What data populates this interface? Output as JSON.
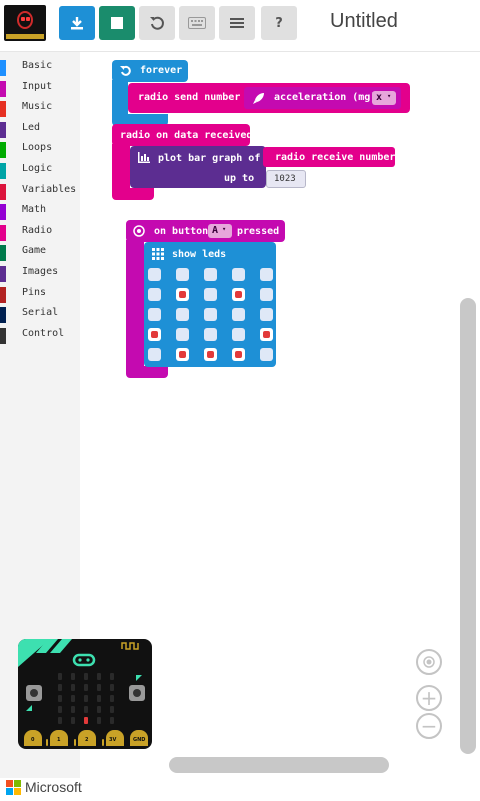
{
  "header": {
    "title": "Untitled",
    "buttons": {
      "download": {
        "icon": "download-icon",
        "color": "#1e90d6"
      },
      "stop": {
        "icon": "stop-icon",
        "color": "#1a8c6c"
      },
      "restart": {
        "icon": "restart-icon",
        "color": "#e0e0e0"
      },
      "keyboard": {
        "icon": "keyboard-icon",
        "color": "#e0e0e0"
      },
      "menu": {
        "icon": "menu-icon",
        "color": "#e0e0e0"
      },
      "help": {
        "label": "?",
        "color": "#e0e0e0"
      }
    }
  },
  "toolbox": {
    "categories": [
      {
        "label": "Basic",
        "color": "#1e90ff"
      },
      {
        "label": "Input",
        "color": "#c40ab0"
      },
      {
        "label": "Music",
        "color": "#e63022"
      },
      {
        "label": "Led",
        "color": "#5c2d91"
      },
      {
        "label": "Loops",
        "color": "#00aa00"
      },
      {
        "label": "Logic",
        "color": "#00a4a6"
      },
      {
        "label": "Variables",
        "color": "#dc143c"
      },
      {
        "label": "Math",
        "color": "#9400d3"
      },
      {
        "label": "Radio",
        "color": "#e3008c"
      },
      {
        "label": "Game",
        "color": "#007a4b"
      },
      {
        "label": "Images",
        "color": "#5c2d91"
      },
      {
        "label": "Pins",
        "color": "#b22222"
      },
      {
        "label": "Serial",
        "color": "#002050"
      },
      {
        "label": "Control",
        "color": "#333333"
      }
    ]
  },
  "blocks": {
    "forever": {
      "label": "forever",
      "icon": "refresh-icon"
    },
    "radio_send": {
      "label": "radio send number",
      "value_label": "acceleration (mg)",
      "value_icon": "rocket-icon",
      "axis": "x"
    },
    "on_data": {
      "label": "radio on data received"
    },
    "plot": {
      "label": "plot bar graph of",
      "up_to_label": "up to",
      "value_label": "radio receive number",
      "max": "1023",
      "icon": "bar-chart-icon"
    },
    "on_button": {
      "label": "on button",
      "button": "A",
      "suffix": "pressed"
    },
    "show_leds": {
      "label": "show leds",
      "icon": "grid-icon",
      "grid": [
        [
          0,
          0,
          0,
          0,
          0
        ],
        [
          0,
          1,
          0,
          1,
          0
        ],
        [
          0,
          0,
          0,
          0,
          0
        ],
        [
          1,
          0,
          0,
          0,
          1
        ],
        [
          0,
          1,
          1,
          1,
          0
        ]
      ]
    }
  },
  "simulator": {
    "pin_labels": [
      "0",
      "1",
      "2",
      "3V",
      "GND"
    ],
    "leds_on": [
      [
        4,
        2
      ]
    ]
  },
  "footer": {
    "brand": "Microsoft"
  }
}
